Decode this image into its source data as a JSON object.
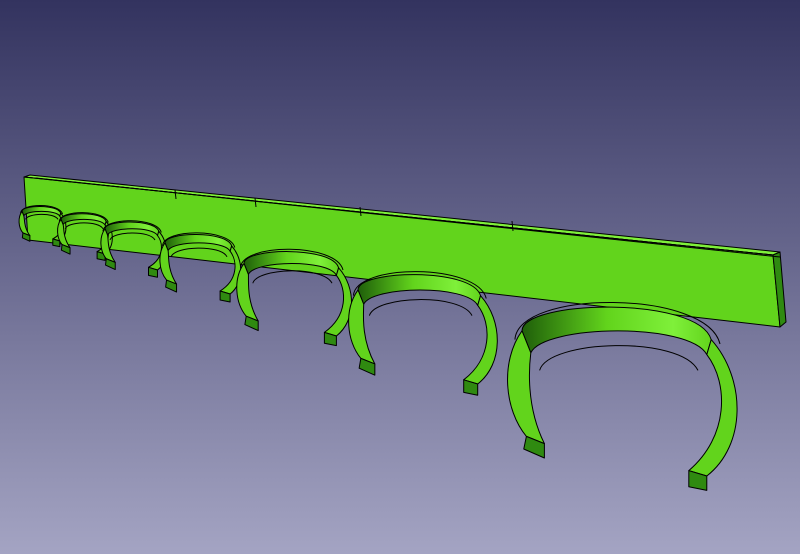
{
  "viewport": {
    "background_top": "#33335f",
    "background_bottom": "#a4a4c3"
  },
  "model": {
    "face_color": "#62d41c",
    "face_light": "#7ff03a",
    "face_shadow": "#2f8a10",
    "face_dark": "#1f5e0a",
    "edge_color": "#000000",
    "clip_count": 7
  }
}
